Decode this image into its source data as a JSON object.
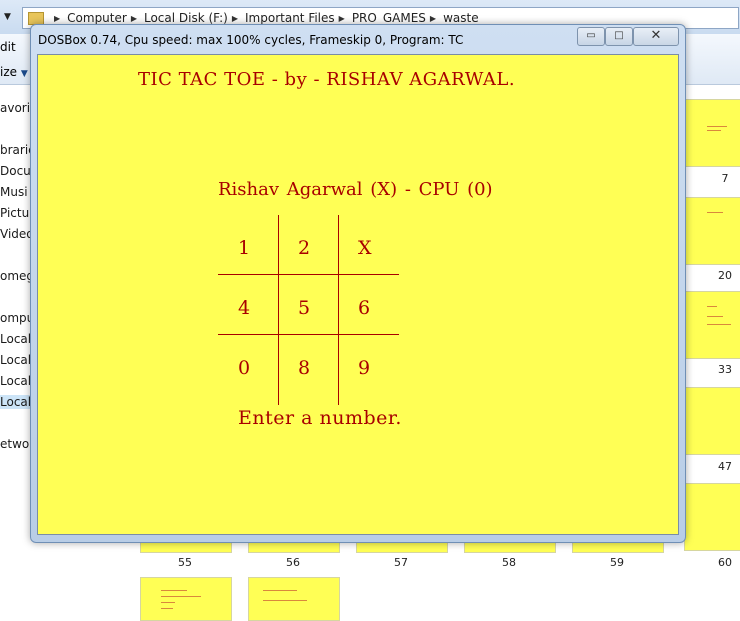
{
  "explorer": {
    "breadcrumb": [
      "Computer",
      "Local Disk (F:)",
      "Important Files",
      "PRO_GAMES",
      "waste"
    ],
    "menu_edit": "dit",
    "menu_size": "ize",
    "nav_items": [
      "avorite",
      "brarie",
      "Docu",
      "Musi",
      "Pictu",
      "Video",
      "omeg",
      "ompu",
      "Local",
      "Local",
      "Local",
      "Local",
      "etwor"
    ],
    "thumb_labels": {
      "r1": "7",
      "r2": "20",
      "r3": "33",
      "r4": "47",
      "b1": "55",
      "b2": "56",
      "b3": "57",
      "b4": "58",
      "b5": "59",
      "b6": "60"
    }
  },
  "dosbox": {
    "title": "DOSBox 0.74, Cpu speed: max 100% cycles, Frameskip  0, Program:      TC",
    "min_glyph": "▭",
    "max_glyph": "□",
    "close_glyph": "✕"
  },
  "game": {
    "title": "TIC TAC TOE - by - RISHAV AGARWAL.",
    "players": "Rishav Agarwal (X)  -   CPU (0)",
    "board": [
      "1",
      "2",
      "X",
      "4",
      "5",
      "6",
      "0",
      "8",
      "9"
    ],
    "prompt": "Enter a number."
  }
}
